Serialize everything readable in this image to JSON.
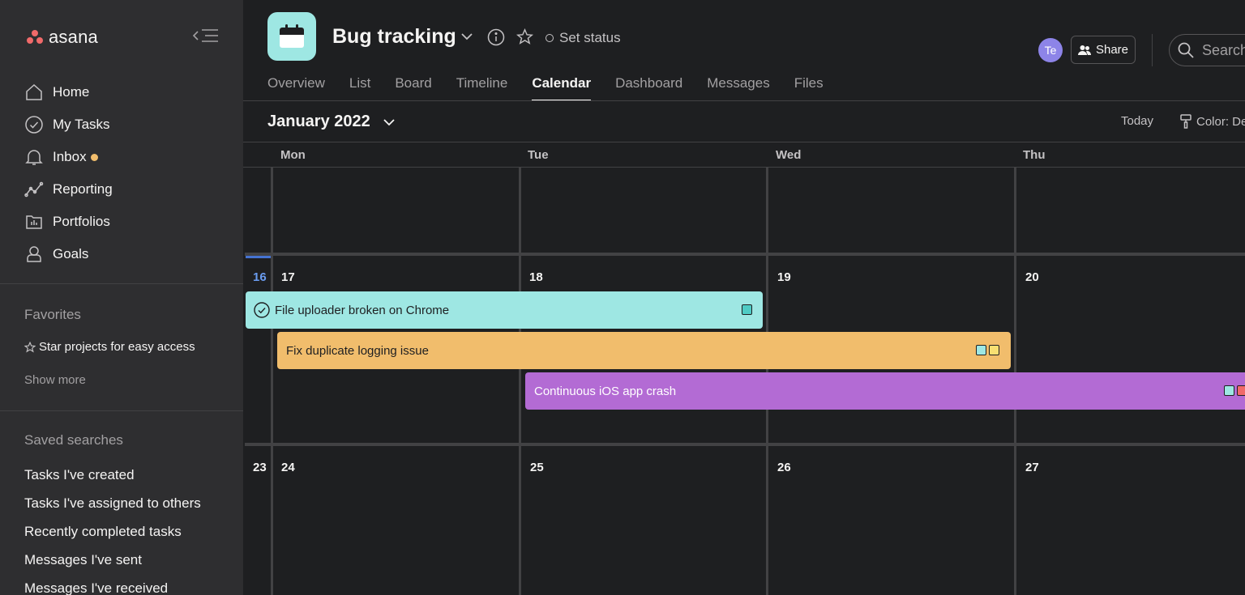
{
  "app": {
    "logo_text": "asana"
  },
  "sidebar": {
    "nav": [
      {
        "label": "Home",
        "icon": "home-icon"
      },
      {
        "label": "My Tasks",
        "icon": "check-circle-icon"
      },
      {
        "label": "Inbox",
        "icon": "bell-icon"
      },
      {
        "label": "Reporting",
        "icon": "reporting-icon"
      },
      {
        "label": "Portfolios",
        "icon": "portfolios-icon"
      },
      {
        "label": "Goals",
        "icon": "goals-icon"
      }
    ],
    "favorites_title": "Favorites",
    "favorites_hint": "Star projects for easy access",
    "show_more": "Show more",
    "saved_title": "Saved searches",
    "saved_searches": [
      "Tasks I've created",
      "Tasks I've assigned to others",
      "Recently completed tasks",
      "Messages I've sent",
      "Messages I've received"
    ]
  },
  "header": {
    "project_title": "Bug tracking",
    "set_status": "Set status",
    "avatar_initials": "Te",
    "share_label": "Share",
    "search_placeholder": "Search",
    "tabs": [
      "Overview",
      "List",
      "Board",
      "Timeline",
      "Calendar",
      "Dashboard",
      "Messages",
      "Files"
    ],
    "active_tab": "Calendar"
  },
  "calendar": {
    "month_label": "January 2022",
    "today_label": "Today",
    "color_label": "Color: De",
    "weekdays": [
      "Mon",
      "Tue",
      "Wed",
      "Thu"
    ],
    "weeks": [
      {
        "week_label": "16",
        "days": [
          "17",
          "18",
          "19",
          "20"
        ]
      },
      {
        "week_label": "23",
        "days": [
          "24",
          "25",
          "26",
          "27"
        ]
      }
    ],
    "tasks": [
      {
        "name": "File uploader broken on Chrome",
        "color": "#9ee7e3",
        "completed": true,
        "tags": [
          "#4ecbc4"
        ]
      },
      {
        "name": "Fix duplicate logging issue",
        "color": "#f1bd6c",
        "completed": false,
        "tags": [
          "#9ee7e3",
          "#f8df72"
        ]
      },
      {
        "name": "Continuous iOS app crash",
        "color": "#b36bd4",
        "completed": false,
        "tags": [
          "#9ee7e3",
          "#f06a6a"
        ]
      }
    ]
  },
  "colors": {
    "accent": "#4573d2",
    "brand": "#f06a6a",
    "inbox_dot": "#f1bd6c",
    "project_icon": "#9ee7e3"
  }
}
